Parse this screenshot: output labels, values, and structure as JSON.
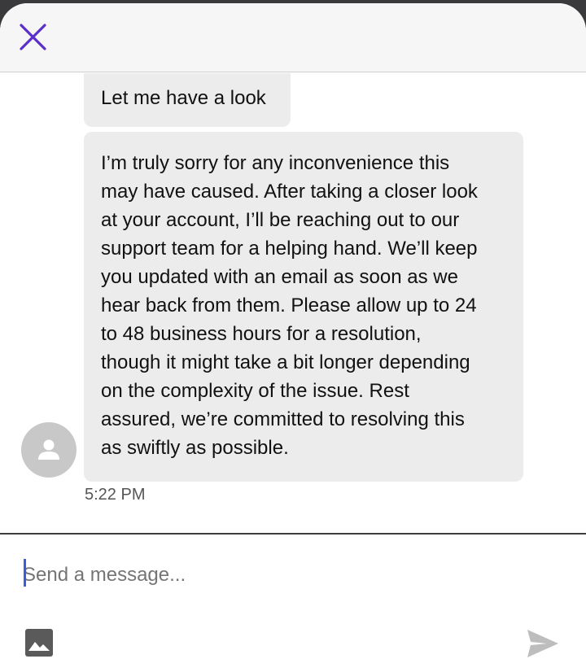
{
  "header": {
    "close_icon": "close-icon",
    "accent_color": "#5b2fc9"
  },
  "messages": [
    {
      "text": "Let me have a look"
    },
    {
      "text": "I’m truly sorry for any inconvenience this\nmay have caused. After taking a closer look\nat your account, I’ll be reaching out to our\nsupport team for a helping hand. We’ll keep\nyou updated with an email as soon as we\nhear back from them. Please allow up to 24\nto 48 business hours for a resolution,\nthough it might take a bit longer depending\non the complexity of the issue. Rest\nassured, we’re committed to resolving this\nas swiftly as possible."
    }
  ],
  "timestamp": "5:22 PM",
  "composer": {
    "placeholder": "Send a message...",
    "attach_icon": "image-icon",
    "send_icon": "send-icon"
  }
}
